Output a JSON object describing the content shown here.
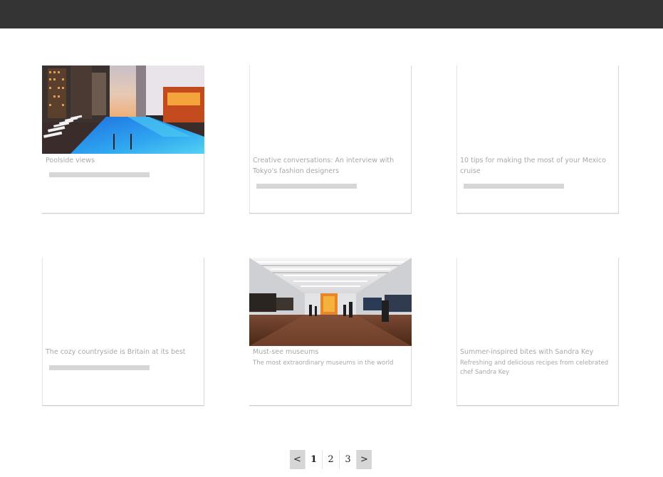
{
  "cards": [
    {
      "title": "Poolside views",
      "description": "",
      "image": "pool-photo"
    },
    {
      "title": "Creative conversations: An interview with Tokyo's fashion designers",
      "description": ""
    },
    {
      "title": "10 tips for making the most of your Mexico cruise",
      "description": ""
    },
    {
      "title": "The cozy countryside is Britain at its best",
      "description": ""
    },
    {
      "title": "Must-see museums",
      "description": "The most extraordinary museums in the world",
      "image": "museum-photo"
    },
    {
      "title": "Summer-inspired bites with Sandra Key",
      "description": "Refreshing and delicious recipes from celebrated chef Sandra Key"
    }
  ],
  "pagination": {
    "prev_label": "<",
    "next_label": ">",
    "pages": [
      "1",
      "2",
      "3"
    ],
    "current": "1"
  },
  "colors": {
    "topbar": "#333333",
    "text_muted": "#a8a8a8",
    "placeholder": "#d6d6d6"
  }
}
